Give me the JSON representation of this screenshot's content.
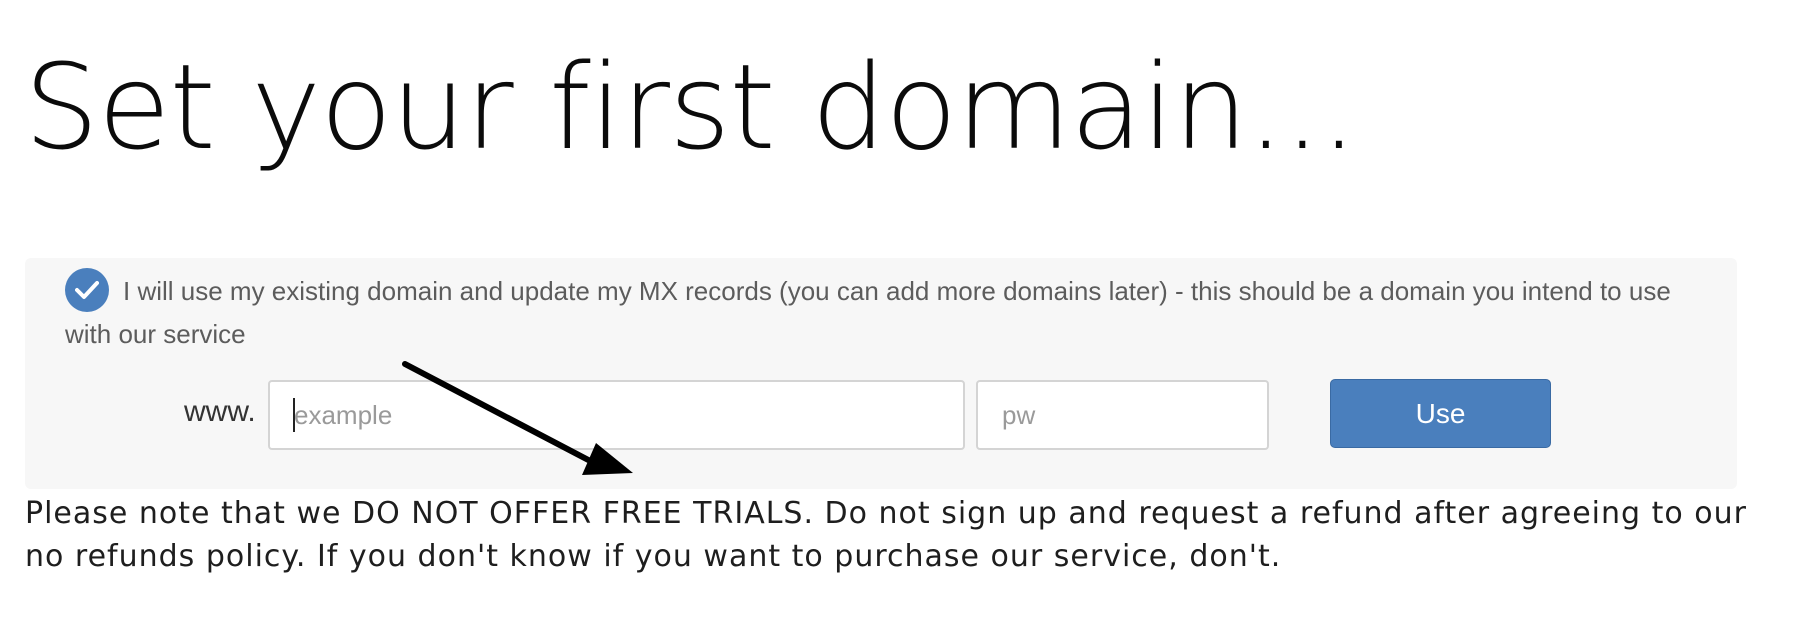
{
  "page": {
    "title": "Set your first domain..."
  },
  "domain_option": {
    "checked": true,
    "label": "I will use my existing domain and update my MX records (you can add more domains later) - this should be a domain you intend to use with our service",
    "check_icon": "check-circle-icon",
    "www_prefix": "www.",
    "domain_input": {
      "value": "",
      "placeholder": "example"
    },
    "tld_input": {
      "value": "",
      "placeholder": "pw"
    },
    "use_button_label": "Use"
  },
  "notice": {
    "text": "Please note that we DO NOT OFFER FREE TRIALS. Do not sign up and request a refund after agreeing to our no refunds policy. If you don't know if you want to purchase our service, don't."
  },
  "annotation": {
    "icon": "arrow-icon",
    "color": "#000000"
  },
  "colors": {
    "accent": "#4a7fbd",
    "panel_background": "#f7f7f7"
  }
}
